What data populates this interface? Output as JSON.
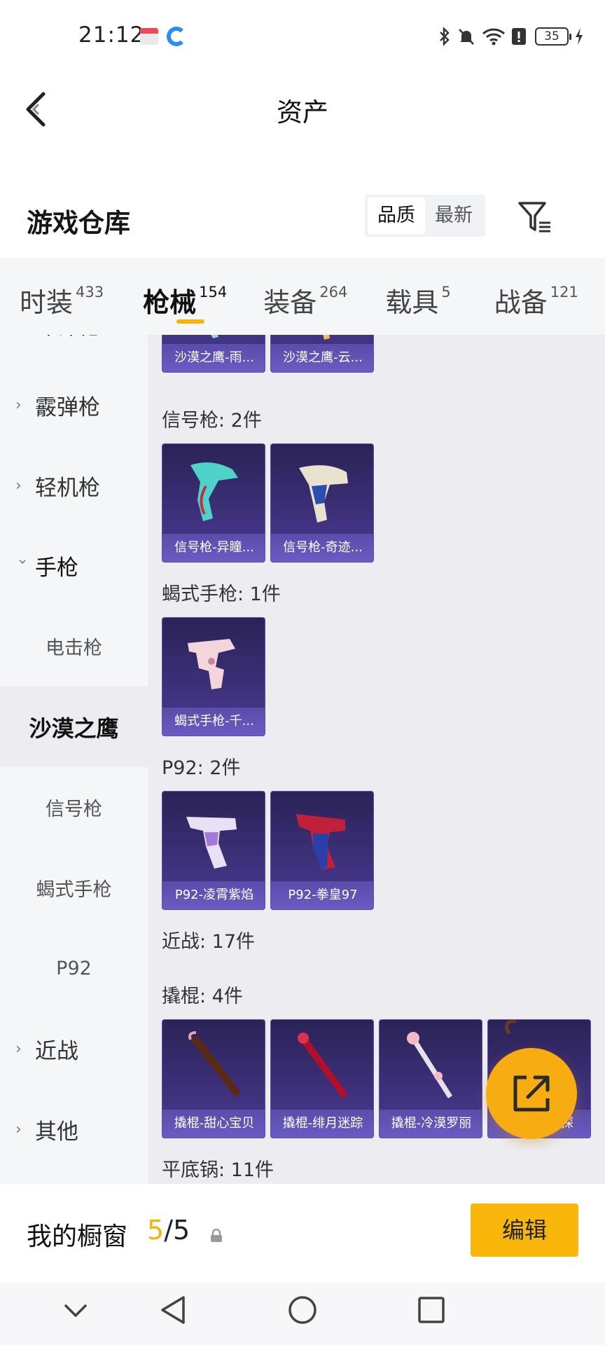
{
  "status_bar": {
    "time": "21:12",
    "battery": "35"
  },
  "header": {
    "title": "资产"
  },
  "warehouse": {
    "title": "游戏仓库",
    "sort_options": [
      "品质",
      "最新"
    ],
    "sort_active": "品质"
  },
  "tabs": [
    {
      "label": "时装",
      "count": "433"
    },
    {
      "label": "枪械",
      "count": "154",
      "active": true
    },
    {
      "label": "装备",
      "count": "264"
    },
    {
      "label": "载具",
      "count": "5"
    },
    {
      "label": "战备",
      "count": "121"
    }
  ],
  "sidebar": {
    "items": [
      {
        "label": "冲锋枪",
        "kind": "collapsed"
      },
      {
        "label": "霰弹枪",
        "kind": "collapsed"
      },
      {
        "label": "轻机枪",
        "kind": "collapsed"
      },
      {
        "label": "手枪",
        "kind": "expanded"
      },
      {
        "label": "电击枪",
        "kind": "sub"
      },
      {
        "label": "沙漠之鹰",
        "kind": "sub",
        "active": true
      },
      {
        "label": "信号枪",
        "kind": "sub"
      },
      {
        "label": "蝎式手枪",
        "kind": "sub"
      },
      {
        "label": "P92",
        "kind": "sub"
      },
      {
        "label": "近战",
        "kind": "collapsed"
      },
      {
        "label": "其他",
        "kind": "collapsed"
      }
    ]
  },
  "sections": [
    {
      "label": "",
      "items": [
        "沙漠之鹰-雨...",
        "沙漠之鹰-云..."
      ]
    },
    {
      "label": "信号枪: 2件",
      "items": [
        "信号枪-异瞳...",
        "信号枪-奇迹..."
      ]
    },
    {
      "label": "蝎式手枪: 1件",
      "items": [
        "蝎式手枪-千..."
      ]
    },
    {
      "label": "P92: 2件",
      "items": [
        "P92-凌霄紫焰",
        "P92-拳皇97"
      ]
    },
    {
      "label": "近战: 17件",
      "items": []
    },
    {
      "label": "撬棍: 4件",
      "items": [
        "撬棍-甜心宝贝",
        "撬棍-绯月迷踪",
        "撬棍-冷漠罗丽",
        "撬棍-...侦探"
      ]
    },
    {
      "label": "平底锅: 11件",
      "items": []
    }
  ],
  "showcase": {
    "title": "我的橱窗",
    "current": "5",
    "total": "/5",
    "edit_label": "编辑"
  },
  "colors": {
    "accent": "#f5b50a",
    "card_bg": "#3c2f78",
    "card_label": "#6a5bc4"
  }
}
